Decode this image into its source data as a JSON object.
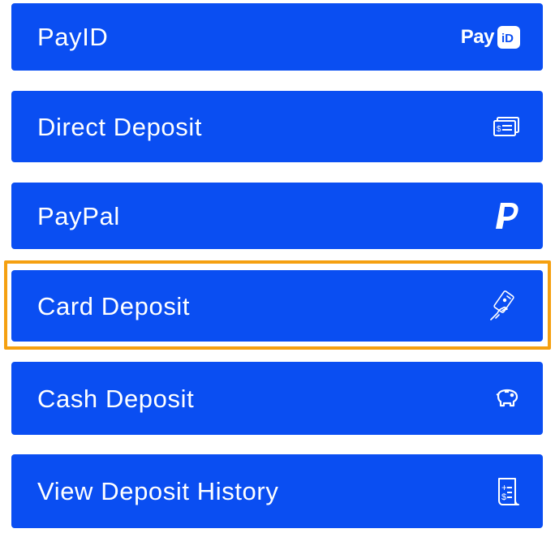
{
  "deposit_options": [
    {
      "label": "PayID",
      "icon": "payid-logo-icon",
      "icon_text": "Pay",
      "icon_badge": "iD"
    },
    {
      "label": "Direct Deposit",
      "icon": "cheque-icon"
    },
    {
      "label": "PayPal",
      "icon": "paypal-logo-icon"
    },
    {
      "label": "Card Deposit",
      "icon": "card-in-hand-icon",
      "highlighted": true
    },
    {
      "label": "Cash Deposit",
      "icon": "piggy-bank-icon"
    },
    {
      "label": "View Deposit History",
      "icon": "receipt-icon"
    }
  ],
  "colors": {
    "button_background": "#0a4ef2",
    "button_text": "#ffffff",
    "highlight_border": "#f5a010"
  }
}
